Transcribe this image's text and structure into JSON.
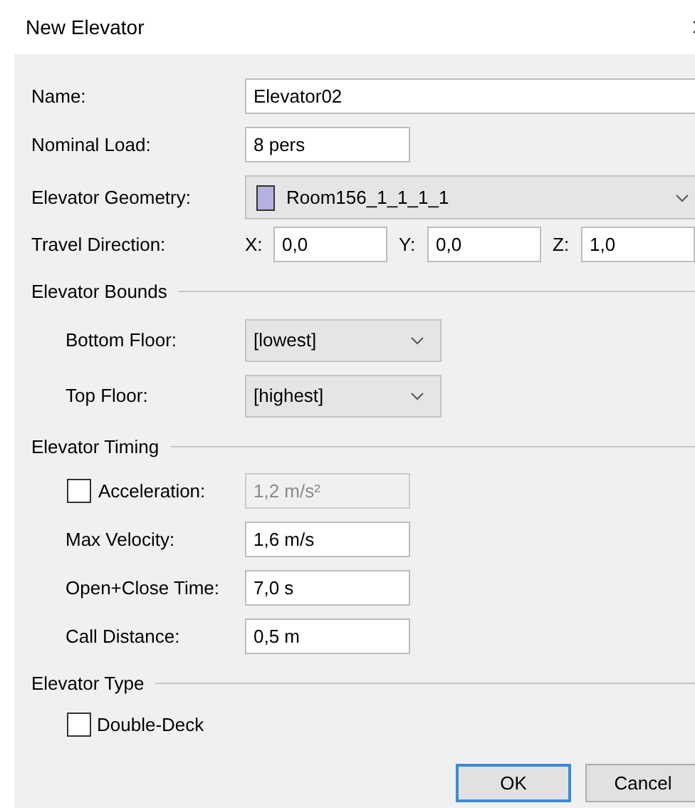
{
  "window": {
    "title": "New Elevator"
  },
  "top_fields": [
    {
      "kind": "text",
      "label": "Name:",
      "value": "Elevator02",
      "wide": true
    },
    {
      "kind": "text",
      "label": "Nominal Load:",
      "value": "8 pers",
      "wide": false
    },
    {
      "kind": "geometry",
      "label": "Elevator Geometry:",
      "value": "Room156_1_1_1_1",
      "color": "#b4b0e0"
    },
    {
      "kind": "vector",
      "label": "Travel Direction:",
      "components": [
        {
          "axis": "X:",
          "value": "0,0"
        },
        {
          "axis": "Y:",
          "value": "0,0"
        },
        {
          "axis": "Z:",
          "value": "1,0"
        }
      ]
    }
  ],
  "sections": [
    {
      "title": "Elevator Bounds",
      "rows": [
        {
          "kind": "select",
          "label": "Bottom Floor:",
          "value": "[lowest]"
        },
        {
          "kind": "select",
          "label": "Top Floor:",
          "value": "[highest]"
        }
      ]
    },
    {
      "title": "Elevator Timing",
      "rows": [
        {
          "kind": "check-text",
          "label": "Acceleration:",
          "checked": false,
          "value": "1,2 m/s²",
          "disabled": true
        },
        {
          "kind": "text",
          "label": "Max Velocity:",
          "value": "1,6 m/s",
          "disabled": false
        },
        {
          "kind": "text",
          "label": "Open+Close Time:",
          "value": "7,0 s",
          "disabled": false
        },
        {
          "kind": "text",
          "label": "Call Distance:",
          "value": "0,5 m",
          "disabled": false
        }
      ]
    },
    {
      "title": "Elevator Type",
      "rows": [
        {
          "kind": "checkbox",
          "label": "Double-Deck",
          "checked": false
        }
      ]
    }
  ],
  "buttons": [
    {
      "label": "OK",
      "default": true
    },
    {
      "label": "Cancel",
      "default": false
    }
  ]
}
